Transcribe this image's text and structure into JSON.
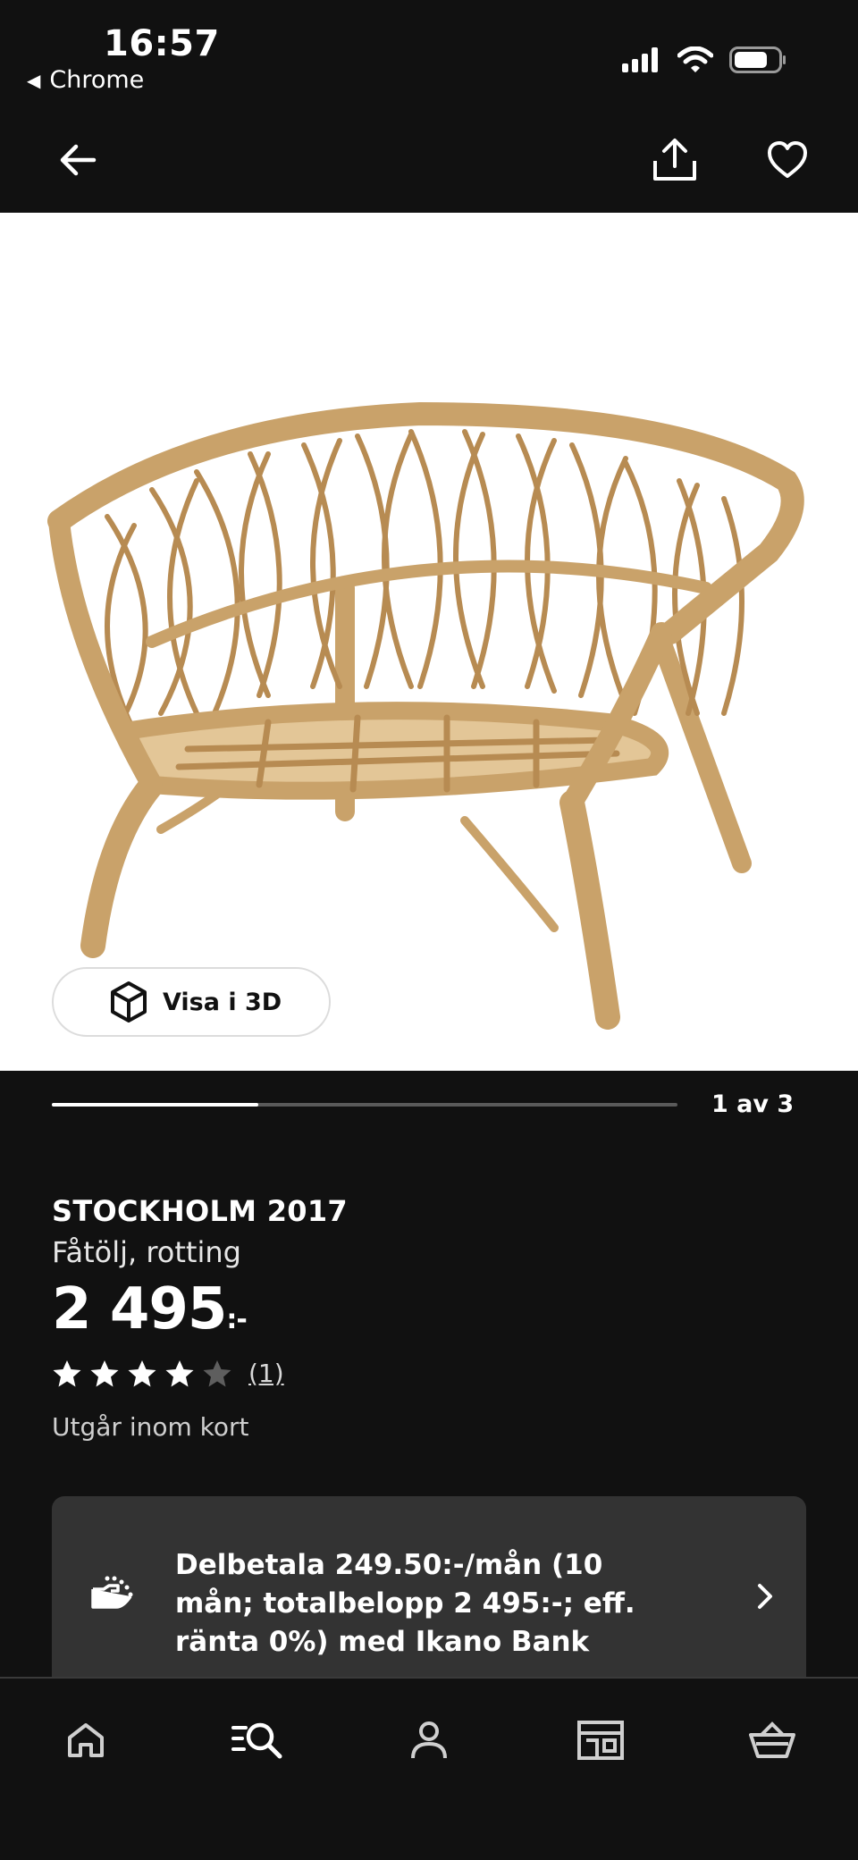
{
  "status_bar": {
    "time": "16:57",
    "back_app": "Chrome"
  },
  "header": {
    "back_icon": "arrow-left-icon",
    "share_icon": "share-icon",
    "favorite_icon": "heart-icon"
  },
  "gallery": {
    "view_3d_label": "Visa i 3D",
    "view_3d_icon": "cube-icon",
    "position_text": "1 av 3",
    "progress_fraction": 0.33
  },
  "product": {
    "name": "STOCKHOLM 2017",
    "description": "Fåtölj, rotting",
    "price": "2 495",
    "price_suffix": ":-",
    "rating": 4,
    "rating_max": 5,
    "review_count": "(1)",
    "availability": "Utgår inom kort"
  },
  "financing": {
    "text": "Delbetala 249.50:-/mån (10 mån; totalbelopp 2 495:-; eff. ränta 0%) med Ikano Bank",
    "icon": "payment-hand-icon"
  },
  "tab_bar": {
    "items": [
      {
        "name": "home",
        "icon": "home-icon"
      },
      {
        "name": "search",
        "icon": "search-icon"
      },
      {
        "name": "profile",
        "icon": "person-icon"
      },
      {
        "name": "store",
        "icon": "store-icon"
      },
      {
        "name": "cart",
        "icon": "basket-icon"
      }
    ]
  },
  "colors": {
    "background": "#111111",
    "card": "#333333",
    "text": "#ffffff",
    "image_background": "#ffffff"
  }
}
